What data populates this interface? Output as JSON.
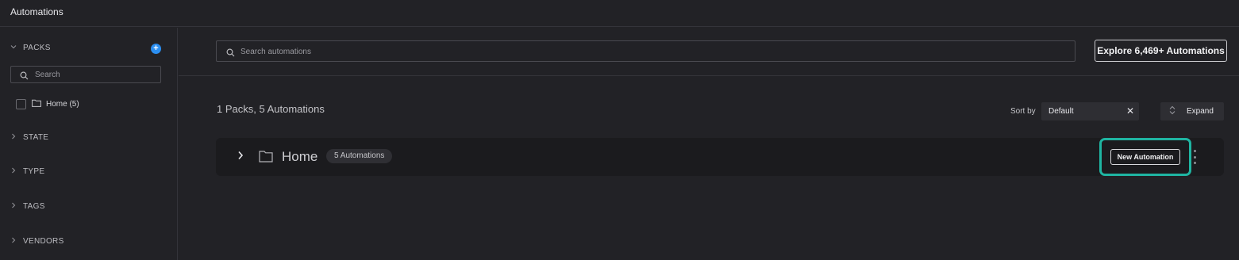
{
  "app": {
    "title": "Automations"
  },
  "sidebar": {
    "packs_label": "PACKS",
    "search_placeholder": "Search",
    "pack_items": [
      {
        "label": "Home (5)",
        "checked": false
      }
    ],
    "sections": [
      {
        "label": "STATE"
      },
      {
        "label": "TYPE"
      },
      {
        "label": "TAGS"
      },
      {
        "label": "VENDORS"
      }
    ]
  },
  "main": {
    "search_placeholder": "Search automations",
    "explore_label": "Explore 6,469+ Automations",
    "summary": "1 Packs, 5 Automations",
    "sort": {
      "label": "Sort by",
      "value": "Default"
    },
    "expand_label": "Expand",
    "packs": [
      {
        "name": "Home",
        "count_text": "5  Automations",
        "action_label": "New Automation"
      }
    ]
  },
  "colors": {
    "background": "#222226",
    "card": "#1b1b1e",
    "accent_blue": "#2b8ef0",
    "highlight_teal": "#1fb5a2"
  },
  "icons": [
    "chevron-down-icon",
    "plus-icon",
    "search-icon",
    "folder-icon",
    "chevron-right-icon",
    "close-icon",
    "expand-icon",
    "kebab-menu-icon"
  ]
}
